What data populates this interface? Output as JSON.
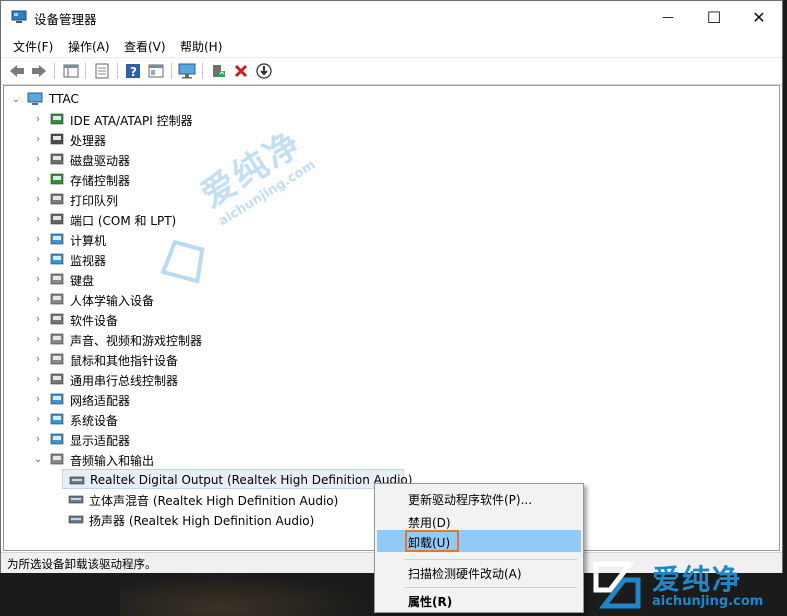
{
  "window": {
    "title": "设备管理器",
    "controls": {
      "minimize": "—",
      "maximize": "☐",
      "close": "✕"
    }
  },
  "menu": [
    "文件(F)",
    "操作(A)",
    "查看(V)",
    "帮助(H)"
  ],
  "toolbar_icons": [
    "back-arrow-icon",
    "forward-arrow-icon",
    "show-hide-tree-icon",
    "properties-icon",
    "help-icon",
    "view-icon",
    "monitor-icon",
    "update-driver-icon",
    "uninstall-x-icon",
    "download-icon"
  ],
  "tree": {
    "root": "TTAC",
    "categories": [
      {
        "label": "IDE ATA/ATAPI 控制器",
        "icon": "ide-controller-icon"
      },
      {
        "label": "处理器",
        "icon": "processor-icon"
      },
      {
        "label": "磁盘驱动器",
        "icon": "disk-drive-icon"
      },
      {
        "label": "存储控制器",
        "icon": "storage-controller-icon"
      },
      {
        "label": "打印队列",
        "icon": "printer-icon"
      },
      {
        "label": "端口 (COM 和 LPT)",
        "icon": "port-icon"
      },
      {
        "label": "计算机",
        "icon": "computer-icon"
      },
      {
        "label": "监视器",
        "icon": "monitor-icon"
      },
      {
        "label": "键盘",
        "icon": "keyboard-icon"
      },
      {
        "label": "人体学输入设备",
        "icon": "hid-icon"
      },
      {
        "label": "软件设备",
        "icon": "software-device-icon"
      },
      {
        "label": "声音、视频和游戏控制器",
        "icon": "sound-icon"
      },
      {
        "label": "鼠标和其他指针设备",
        "icon": "mouse-icon"
      },
      {
        "label": "通用串行总线控制器",
        "icon": "usb-icon"
      },
      {
        "label": "网络适配器",
        "icon": "network-icon"
      },
      {
        "label": "系统设备",
        "icon": "system-device-icon"
      },
      {
        "label": "显示适配器",
        "icon": "display-adapter-icon"
      },
      {
        "label": "音频输入和输出",
        "icon": "audio-io-icon"
      }
    ],
    "audio_children": [
      {
        "label": "Realtek Digital Output (Realtek High Definition Audio)",
        "icon": "digital-output-icon"
      },
      {
        "label": "立体声混音 (Realtek High Definition Audio)",
        "icon": "stereo-mix-icon"
      },
      {
        "label": "扬声器 (Realtek High Definition Audio)",
        "icon": "speaker-icon"
      }
    ]
  },
  "context_menu": {
    "update": "更新驱动程序软件(P)...",
    "disable": "禁用(D)",
    "uninstall": "卸载(U)",
    "scan": "扫描检测硬件改动(A)",
    "properties": "属性(R)"
  },
  "status": "为所选设备卸载该驱动程序。",
  "watermark": {
    "brand": "爱纯净",
    "url": "aichunjing.com"
  },
  "colors": {
    "highlight": "#91c9f7",
    "accent_box": "#e0782a",
    "watermark": "#1f86c7"
  }
}
